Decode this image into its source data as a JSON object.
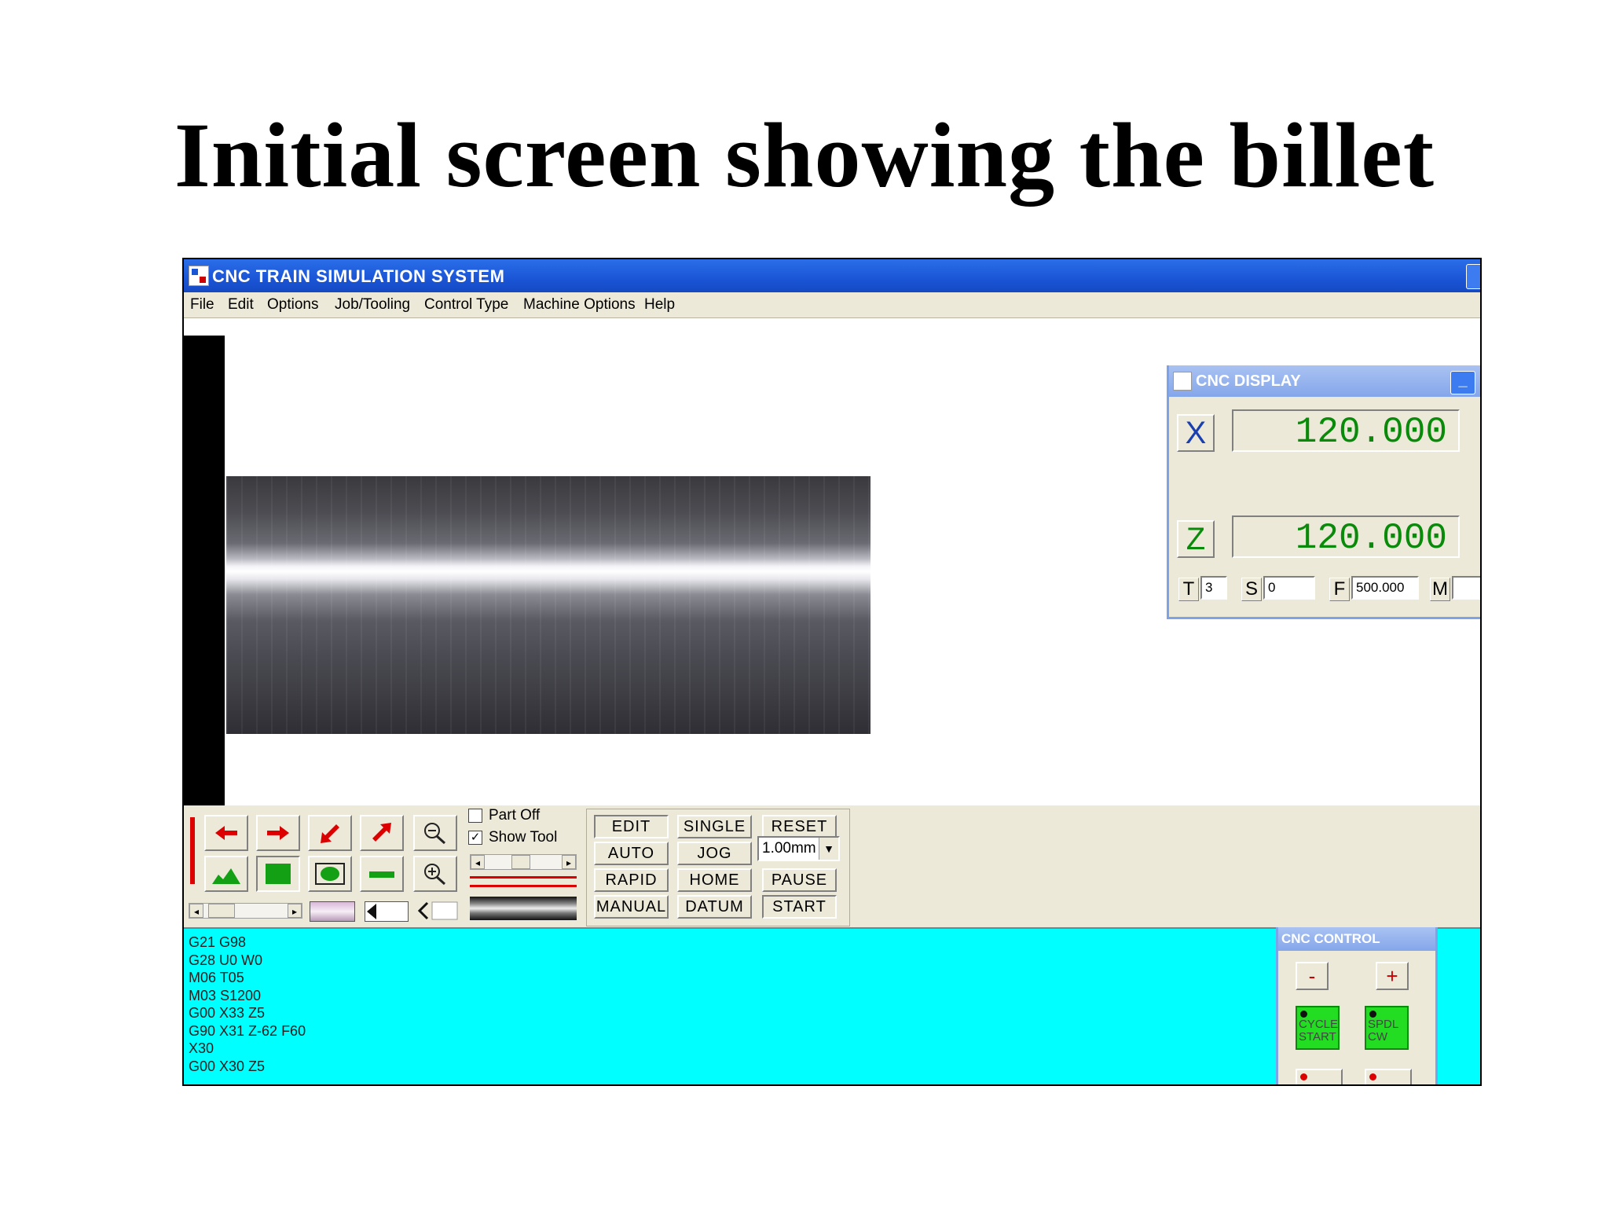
{
  "slide": {
    "title": "Initial screen showing the billet"
  },
  "window": {
    "title": "CNC TRAIN SIMULATION SYSTEM"
  },
  "menu": [
    "File",
    "Edit",
    "Options",
    "Job/Tooling",
    "Control Type",
    "Machine Options",
    "Help"
  ],
  "display": {
    "title": "CNC DISPLAY",
    "minimize": "_",
    "x_label": "X",
    "x_value": "120.000",
    "z_label": "Z",
    "z_value": "120.000",
    "t_label": "T",
    "t_value": "3",
    "s_label": "S",
    "s_value": "0",
    "f_label": "F",
    "f_value": "500.000",
    "m_label": "M",
    "m_value": ""
  },
  "options": {
    "part_off": "Part Off",
    "show_tool": "Show Tool",
    "show_tool_checked": "✓"
  },
  "mode_buttons": [
    "EDIT",
    "AUTO",
    "RAPID",
    "MANUAL"
  ],
  "run_buttons": [
    "SINGLE",
    "JOG",
    "HOME",
    "DATUM"
  ],
  "action_buttons": {
    "reset": "RESET",
    "pause": "PAUSE",
    "start": "START"
  },
  "jog_step": "1.00mm",
  "program": {
    "lines": [
      "G21 G98",
      "G28 U0 W0",
      "M06 T05",
      "M03 S1200",
      "G00 X33 Z5",
      "G90 X31 Z-62 F60",
      "X30",
      "G00 X30 Z5"
    ]
  },
  "control": {
    "title": "CNC CONTROL",
    "minus": "-",
    "plus": "+",
    "cycle_start": "CYCLE START",
    "spindle_cw": "SPDL CW"
  },
  "colors": {
    "program_bg": "#00ffff",
    "readout": "#0a8a0a",
    "titlebar": "#1a55d6",
    "control_green": "#22dd22"
  },
  "icons": [
    "arrow-left-icon",
    "arrow-right-icon",
    "arrow-down-left-icon",
    "arrow-up-right-icon",
    "zoom-out-icon",
    "zoom-in-icon",
    "profile-icon",
    "billet-solid-icon",
    "fit-view-icon",
    "bar-icon"
  ]
}
